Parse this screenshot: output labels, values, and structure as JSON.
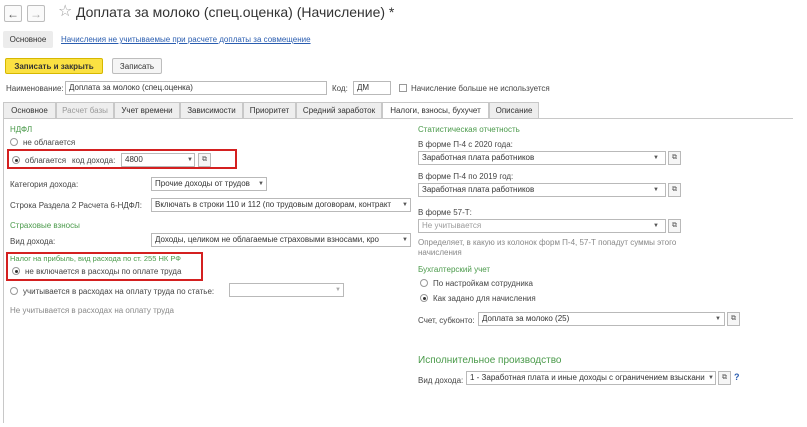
{
  "window": {
    "title": "Доплата за молоко (спец.оценка) (Начисление) *",
    "back_icon": "arrow-left-icon",
    "forward_icon": "arrow-right-icon",
    "favorite_icon": "star-icon"
  },
  "subnav": {
    "main_label": "Основное",
    "link_label": "Начисления не учитываемые при расчете доплаты за совмещение"
  },
  "toolbar": {
    "save_close_label": "Записать и закрыть",
    "save_label": "Записать"
  },
  "header_fields": {
    "name_label": "Наименование:",
    "name_value": "Доплата за молоко (спец.оценка)",
    "code_label": "Код:",
    "code_value": "ДМ",
    "unused_label": "Начисление больше не используется",
    "unused_checked": false
  },
  "tabs": [
    {
      "label": "Основное",
      "active": false,
      "disabled": false
    },
    {
      "label": "Расчет базы",
      "active": false,
      "disabled": true
    },
    {
      "label": "Учет времени",
      "active": false,
      "disabled": false
    },
    {
      "label": "Зависимости",
      "active": false,
      "disabled": false
    },
    {
      "label": "Приоритет",
      "active": false,
      "disabled": false
    },
    {
      "label": "Средний заработок",
      "active": false,
      "disabled": false
    },
    {
      "label": "Налоги, взносы, бухучет",
      "active": true,
      "disabled": false
    },
    {
      "label": "Описание",
      "active": false,
      "disabled": false
    }
  ],
  "ndfl": {
    "section_title": "НДФЛ",
    "not_taxed_label": "не облагается",
    "taxed_label": "облагается",
    "income_code_label": "код дохода:",
    "income_code_value": "4800",
    "category_label": "Категория дохода:",
    "category_value": "Прочие доходы от трудов",
    "line_label": "Строка Раздела 2 Расчета 6-НДФЛ:",
    "line_value": "Включать в строки 110 и 112 (по трудовым договорам, контракт"
  },
  "insurance": {
    "section_title": "Страховые взносы",
    "income_type_label": "Вид дохода:",
    "income_type_value": "Доходы, целиком не облагаемые страховыми взносами, кро"
  },
  "profit_tax": {
    "section_title": "Налог на прибыль, вид расхода по ст. 255 НК РФ",
    "not_included_label": "не включается в расходы по оплате труда",
    "included_label": "учитывается в расходах на оплату труда по статье:",
    "included_value": "",
    "hint": "Не учитывается в расходах на оплату труда"
  },
  "statistics": {
    "section_title": "Статистическая отчетность",
    "p4_2020_label": "В форме П-4 с 2020 года:",
    "p4_2020_value": "Заработная плата работников",
    "p4_2019_label": "В форме П-4 по 2019 год:",
    "p4_2019_value": "Заработная плата работников",
    "f57_label": "В форме 57-Т:",
    "f57_placeholder": "Не учитывается",
    "note": "Определяет, в какую из колонок форм П-4, 57-Т попадут суммы этого начисления"
  },
  "accounting": {
    "section_title": "Бухгалтерский учет",
    "by_employee_label": "По настройкам сотрудника",
    "as_set_label": "Как задано для начисления",
    "account_label": "Счет, субконто:",
    "account_value": "Доплата за молоко (25)"
  },
  "enforcement": {
    "section_title": "Исполнительное производство",
    "income_type_label": "Вид дохода:",
    "income_type_value": "1 - Заработная плата и иные доходы с ограничением взыскани",
    "help_label": "?"
  },
  "colors": {
    "accent_yellow": "#fbe142",
    "section_green": "#4a9a4a",
    "highlight_red": "#d42020",
    "link_blue": "#2a5db0"
  }
}
